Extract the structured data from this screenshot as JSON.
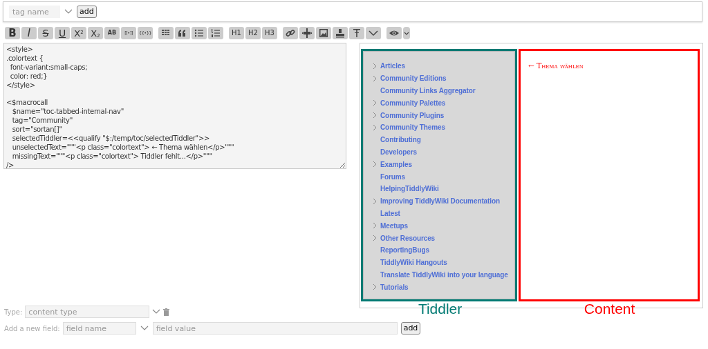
{
  "tag_bar": {
    "placeholder": "tag name",
    "button": "add"
  },
  "toolbar": [
    {
      "kind": "text",
      "label": "B"
    },
    {
      "kind": "text",
      "label": "I"
    },
    {
      "kind": "text",
      "label": "S"
    },
    {
      "kind": "text",
      "label": "U"
    },
    {
      "kind": "text",
      "label": "X$^{2}$"
    },
    {
      "kind": "text",
      "label": "X$_{2}$"
    },
    {
      "kind": "text",
      "label": "AB"
    },
    {
      "kind": "text",
      "label": "[[•]]"
    },
    {
      "kind": "text",
      "label": "{{•}}"
    },
    {
      "kind": "icon"
    },
    {
      "kind": "icon"
    },
    {
      "kind": "icon"
    },
    {
      "kind": "icon"
    },
    {
      "kind": "text",
      "label": "H1"
    },
    {
      "kind": "text",
      "label": "H2"
    },
    {
      "kind": "text",
      "label": "H3"
    },
    {
      "kind": "icon"
    },
    {
      "kind": "icon"
    },
    {
      "kind": "icon"
    },
    {
      "kind": "icon"
    },
    {
      "kind": "icon"
    },
    {
      "kind": "icon"
    },
    {
      "kind": "icon"
    },
    {
      "kind": "icon"
    }
  ],
  "editor": {
    "text": "<style>\n.colortext {\n  font-variant:small-caps;\n  color: red;}\n</style>\n\n<$macrocall\n   $name=\"toc-tabbed-internal-nav\"\n   tag=\"Community\"\n   sort=\"sortan[]\"\n   selectedTiddler=<<qualify \"$:/temp/toc/selectedTiddler\">>\n   unselectedText=\"\"\"<p class=\"colortext\"> ← Thema wählen</p>\"\"\"\n   missingText=\"\"\"<p class=\"colortext\"> Tiddler fehlt...</p>\"\"\"\n/>"
  },
  "preview": {
    "toc": [
      {
        "label": "Articles",
        "expandable": true
      },
      {
        "label": "Community Editions",
        "expandable": true
      },
      {
        "label": "Community Links Aggregator",
        "expandable": false
      },
      {
        "label": "Community Palettes",
        "expandable": true
      },
      {
        "label": "Community Plugins",
        "expandable": true
      },
      {
        "label": "Community Themes",
        "expandable": true
      },
      {
        "label": "Contributing",
        "expandable": false
      },
      {
        "label": "Developers",
        "expandable": false
      },
      {
        "label": "Examples",
        "expandable": true
      },
      {
        "label": "Forums",
        "expandable": false
      },
      {
        "label": "HelpingTiddlyWiki",
        "expandable": false
      },
      {
        "label": "Improving TiddlyWiki Documentation",
        "expandable": true
      },
      {
        "label": "Latest",
        "expandable": false
      },
      {
        "label": "Meetups",
        "expandable": true
      },
      {
        "label": "Other Resources",
        "expandable": true
      },
      {
        "label": "ReportingBugs",
        "expandable": false
      },
      {
        "label": "TiddlyWiki Hangouts",
        "expandable": false
      },
      {
        "label": "Translate TiddlyWiki into your language",
        "expandable": false
      },
      {
        "label": "Tutorials",
        "expandable": true
      }
    ],
    "content_text": "← Thema wählen",
    "annotations": [
      {
        "label": "Tiddler",
        "color": "#007a73"
      },
      {
        "label": "Content",
        "color": "#ff0000"
      }
    ]
  },
  "type_row": {
    "label": "Type:",
    "placeholder": "content type"
  },
  "field_row": {
    "label": "Add a new field:",
    "name_placeholder": "field name",
    "value_placeholder": "field value",
    "button": "add"
  }
}
